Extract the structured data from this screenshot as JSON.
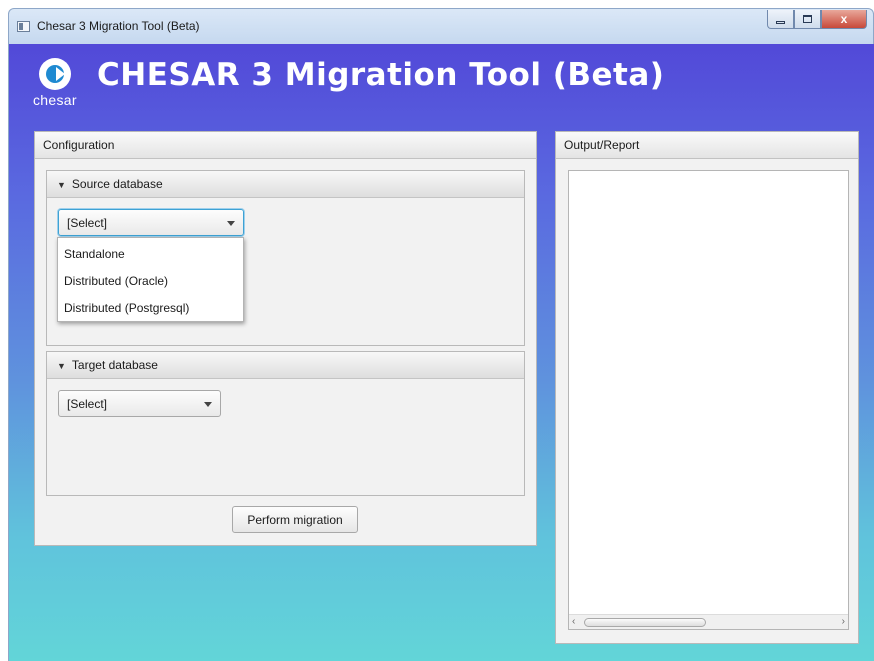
{
  "window": {
    "title": "Chesar 3 Migration Tool (Beta)",
    "close_glyph": "x"
  },
  "brand": {
    "logo_text": "chesar",
    "app_title": "CHESAR 3 Migration Tool (Beta)"
  },
  "configuration": {
    "header": "Configuration",
    "source": {
      "header": "Source database",
      "selected": "[Select]",
      "options": [
        "Standalone",
        "Distributed (Oracle)",
        "Distributed (Postgresql)"
      ]
    },
    "target": {
      "header": "Target database",
      "selected": "[Select]"
    },
    "perform_button": "Perform migration"
  },
  "output": {
    "header": "Output/Report",
    "content": ""
  },
  "colors": {
    "background_top": "#5249d8",
    "background_bottom": "#62d5d8",
    "focus": "#3ea2d4",
    "logo_blue": "#1f8ad1"
  },
  "icons": [
    "app-window-icon",
    "minimize-icon",
    "maximize-icon",
    "close-icon",
    "chesar-logo-icon",
    "collapse-triangle-icon",
    "dropdown-arrow-icon"
  ]
}
